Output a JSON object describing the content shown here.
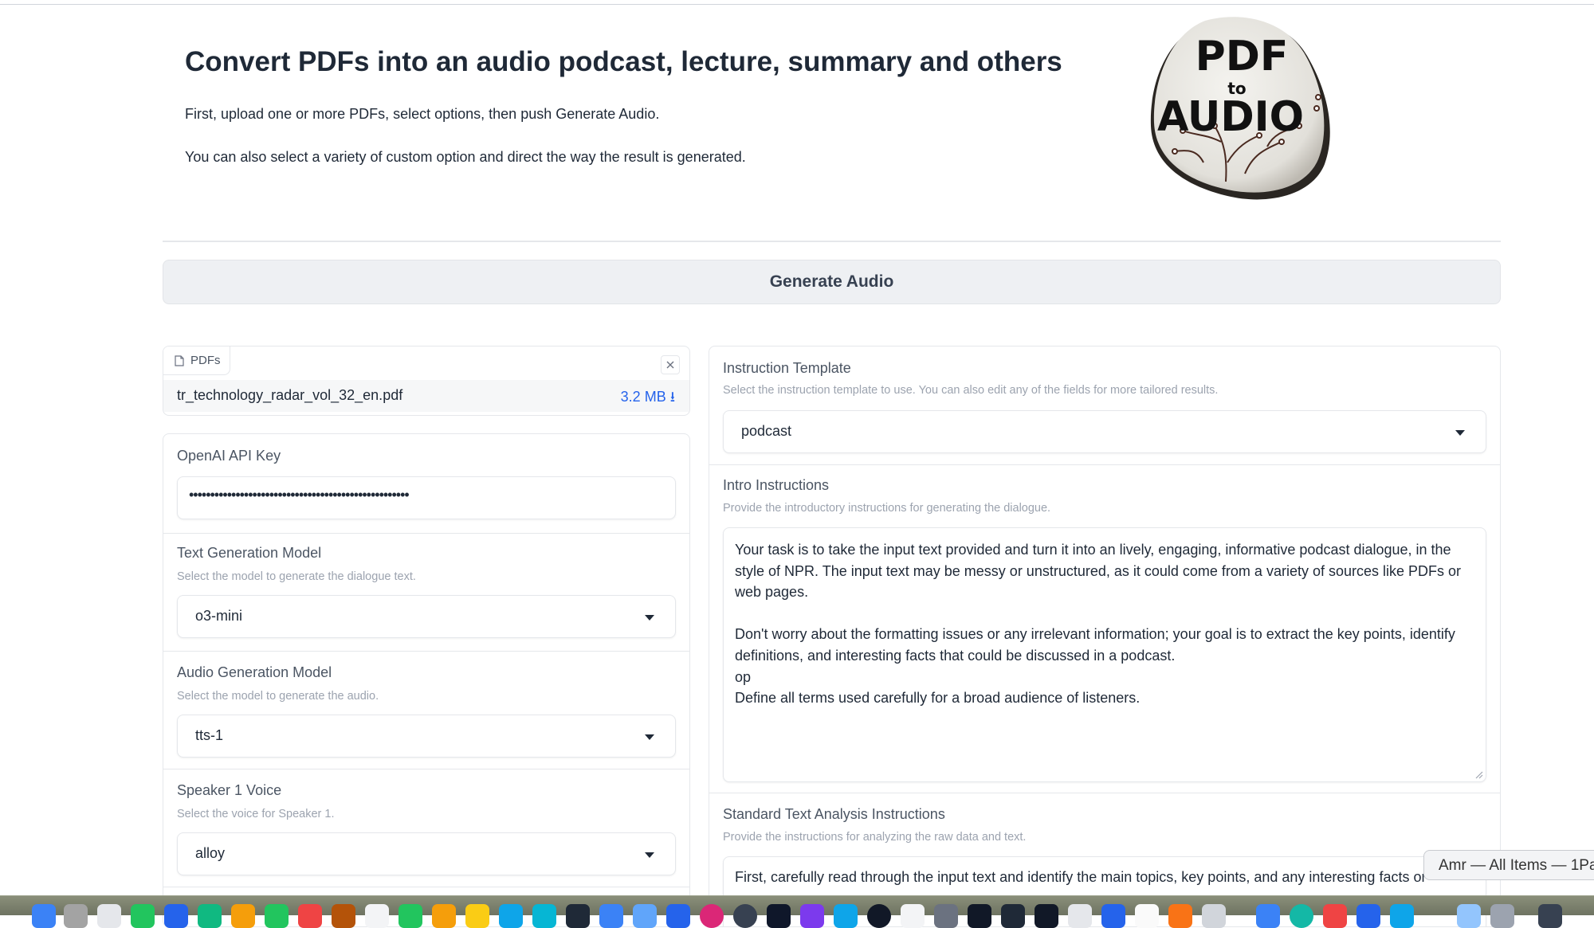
{
  "header": {
    "title": "Convert PDFs into an audio podcast, lecture, summary and others",
    "desc1": "First, upload one or more PDFs, select options, then push Generate Audio.",
    "desc2": "You can also select a variety of custom option and direct the way the result is generated.",
    "logo_text_pdf": "PDF",
    "logo_text_to": "to",
    "logo_text_audio": "AUDIO"
  },
  "generate_button": "Generate Audio",
  "files": {
    "tab_label": "PDFs",
    "file_name": "tr_technology_radar_vol_32_en.pdf",
    "file_size": "3.2 MB ⭳"
  },
  "api_key": {
    "label": "OpenAI API Key",
    "value_masked": "••••••••••••••••••••••••••••••••••••••••••••••••••••"
  },
  "text_model": {
    "label": "Text Generation Model",
    "info": "Select the model to generate the dialogue text.",
    "value": "o3-mini"
  },
  "audio_model": {
    "label": "Audio Generation Model",
    "info": "Select the model to generate the audio.",
    "value": "tts-1"
  },
  "speaker1": {
    "label": "Speaker 1 Voice",
    "info": "Select the voice for Speaker 1.",
    "value": "alloy"
  },
  "template": {
    "label": "Instruction Template",
    "info": "Select the instruction template to use. You can also edit any of the fields for more tailored results.",
    "value": "podcast"
  },
  "intro": {
    "label": "Intro Instructions",
    "info": "Provide the introductory instructions for generating the dialogue.",
    "text": "Your task is to take the input text provided and turn it into an lively, engaging, informative podcast dialogue, in the style of NPR. The input text may be messy or unstructured, as it could come from a variety of sources like PDFs or web pages.\n\nDon't worry about the formatting issues or any irrelevant information; your goal is to extract the key points, identify definitions, and interesting facts that could be discussed in a podcast.\nop\nDefine all terms used carefully for a broad audience of listeners."
  },
  "analysis": {
    "label": "Standard Text Analysis Instructions",
    "info": "Provide the instructions for analyzing the raw data and text.",
    "text": "First, carefully read through the input text and identify the main topics, key points, and any interesting facts or"
  },
  "tooltip": "Amr — All Items — 1Pa",
  "colors": {
    "link": "#2563eb",
    "button_bg": "#eef0f3",
    "border": "#e5e7eb"
  }
}
